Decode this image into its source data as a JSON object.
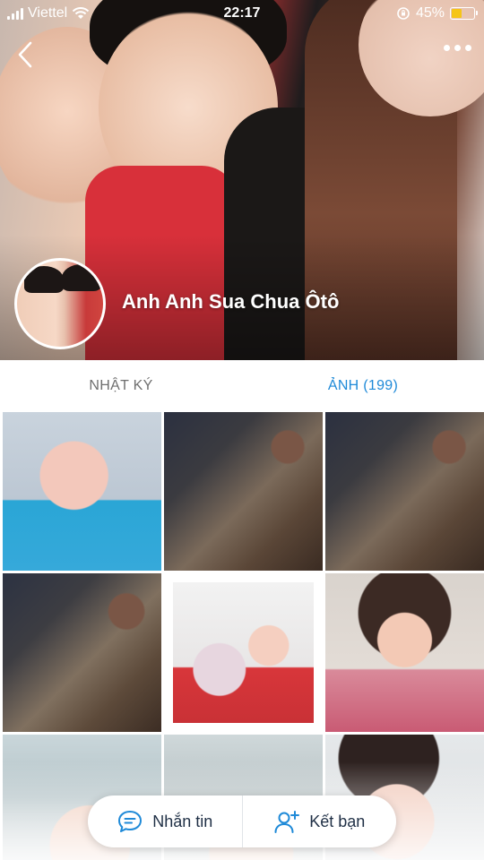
{
  "status_bar": {
    "carrier": "Viettel",
    "time": "22:17",
    "battery_percent": "45%",
    "battery_level": 0.45
  },
  "profile": {
    "name": "Anh Anh Sua Chua Ôtô"
  },
  "tabs": [
    {
      "label": "NHẬT KÝ",
      "active": false
    },
    {
      "label": "ẢNH (199)",
      "active": true
    }
  ],
  "actions": {
    "message_label": "Nhắn tin",
    "add_friend_label": "Kết bạn"
  },
  "colors": {
    "accent": "#1f8ad8",
    "battery_fill": "#f5c518"
  },
  "icons": {
    "back": "back-icon",
    "more": "more-icon",
    "message": "chat-bubble-icon",
    "add_friend": "add-friend-icon"
  }
}
